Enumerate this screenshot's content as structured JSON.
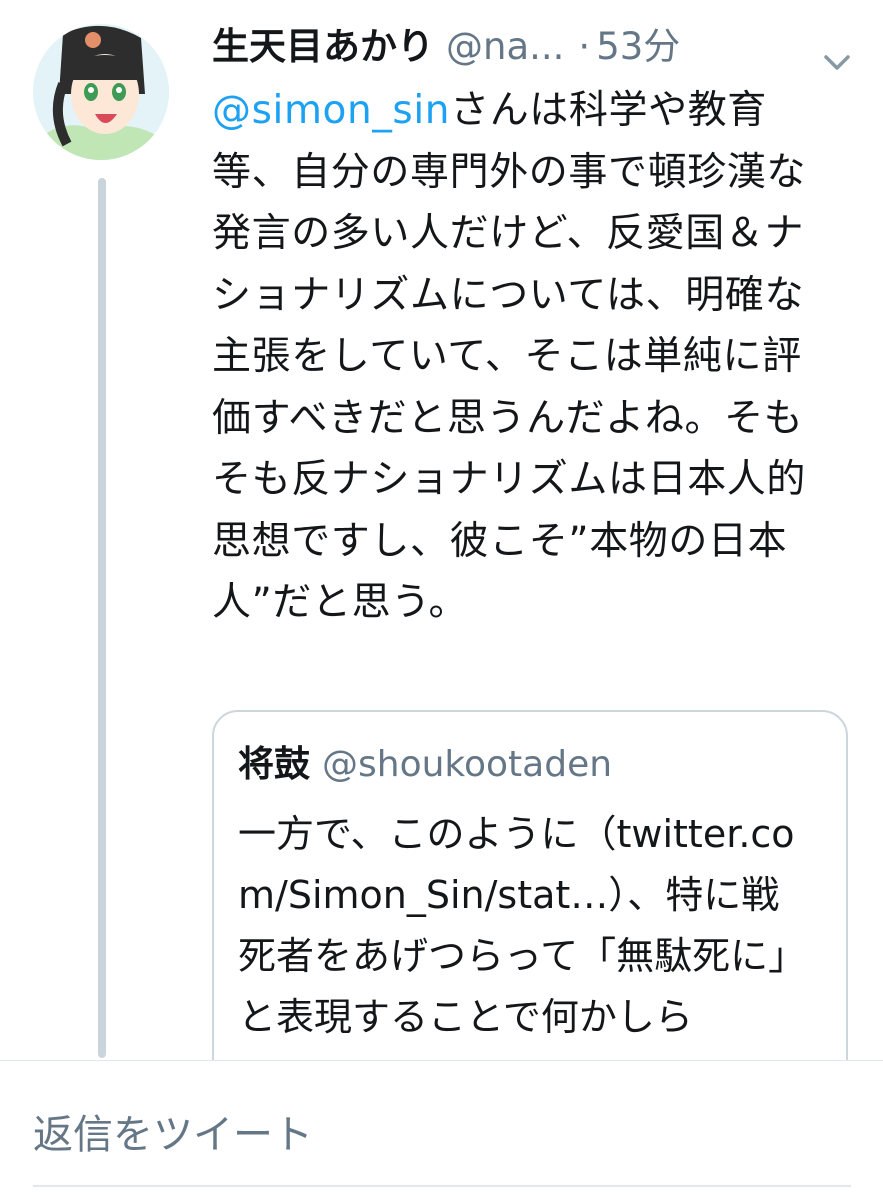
{
  "tweet": {
    "display_name": "生天目あかり",
    "handle": "@na...",
    "separator": "·",
    "time_ago": "53分",
    "mention": "@simon_sin",
    "text_after_mention": "さんは科学や教育等、自分の専門外の事で頓珍漢な発言の多い人だけど、反愛国＆ナショナリズムについては、明確な主張をしていて、そこは単純に評価すべきだと思うんだよね。そもそも反ナショナリズムは日本人的思想ですし、彼こそ”本物の日本人”だと思う。"
  },
  "quoted_tweet": {
    "display_name": "将鼓",
    "handle": "@shoukootaden",
    "text": "一方で、このように（twitter.com/Simon_Sin/stat…）、特に戦死者をあげつらって「無駄死に」と表現することで何かしら"
  },
  "reply": {
    "placeholder": "返信をツイート"
  },
  "icons": {
    "menu": "chevron-down-icon",
    "avatar": "anime-girl-avatar"
  },
  "colors": {
    "link": "#1da1f2",
    "secondary_text": "#657786",
    "thread_line": "#c9d4dc",
    "border": "#ccd6dd"
  }
}
